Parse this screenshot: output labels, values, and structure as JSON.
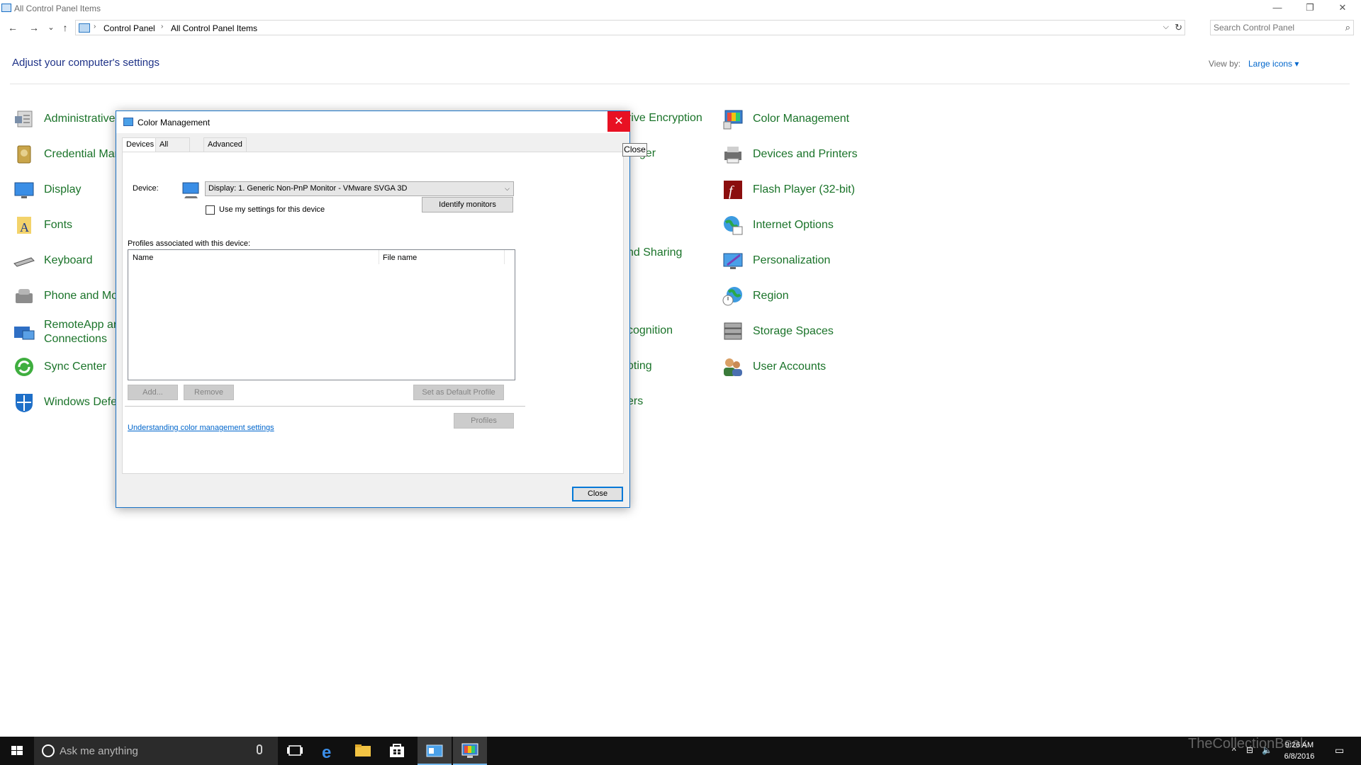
{
  "window": {
    "title": "All Control Panel Items",
    "minimize_glyph": "—",
    "restore_glyph": "❐",
    "close_glyph": "✕"
  },
  "nav": {
    "back_glyph": "←",
    "forward_glyph": "→",
    "recent_glyph": "⌄",
    "up_glyph": "↑",
    "breadcrumb": [
      "Control Panel",
      "All Control Panel Items"
    ],
    "search_placeholder": "Search Control Panel"
  },
  "content": {
    "heading": "Adjust your computer's settings",
    "view_by_label": "View by:",
    "view_by_value": "Large icons ▾"
  },
  "items": {
    "col1": [
      {
        "label": "Administrative",
        "icon": "admin-tools-icon"
      },
      {
        "label": "Credential Mar",
        "icon": "credential-icon"
      },
      {
        "label": "Display",
        "icon": "display-icon"
      },
      {
        "label": "Fonts",
        "icon": "fonts-icon"
      },
      {
        "label": "Keyboard",
        "icon": "keyboard-icon"
      },
      {
        "label": "Phone and Mo",
        "icon": "phone-modem-icon"
      },
      {
        "label": "RemoteApp an",
        "label2": "Connections",
        "icon": "remoteapp-icon"
      },
      {
        "label": "Sync Center",
        "icon": "sync-icon"
      },
      {
        "label": "Windows Defe",
        "icon": "defender-icon"
      }
    ],
    "col3_fragments": [
      "rive Encryption",
      "ager",
      "nd Sharing",
      "cognition",
      "oting",
      "ers"
    ],
    "col4": [
      {
        "label": "Color Management",
        "icon": "color-management-icon"
      },
      {
        "label": "Devices and Printers",
        "icon": "printer-icon"
      },
      {
        "label": "Flash Player (32-bit)",
        "icon": "flash-icon"
      },
      {
        "label": "Internet Options",
        "icon": "internet-options-icon"
      },
      {
        "label": "Personalization",
        "icon": "personalization-icon"
      },
      {
        "label": "Region",
        "icon": "region-icon"
      },
      {
        "label": "Storage Spaces",
        "icon": "storage-icon"
      },
      {
        "label": "User Accounts",
        "icon": "users-icon"
      }
    ]
  },
  "dialog": {
    "title": "Color Management",
    "close_glyph": "✕",
    "tooltip": "Close",
    "tabs": [
      "Devices",
      "All Profiles",
      "Advanced"
    ],
    "device_label": "Device:",
    "device_value": "Display: 1. Generic Non-PnP Monitor - VMware SVGA 3D",
    "device_arrow": "⌵",
    "use_settings_label": "Use my settings for this device",
    "identify_button": "Identify monitors",
    "profiles_label": "Profiles associated with this device:",
    "columns": [
      "Name",
      "File name"
    ],
    "add_button": "Add...",
    "remove_button": "Remove",
    "set_default_button": "Set as Default Profile",
    "profiles_button": "Profiles",
    "help_link": "Understanding color management settings",
    "close_button": "Close"
  },
  "taskbar": {
    "search_placeholder": "Ask me anything",
    "time": "9:26 AM",
    "date": "6/8/2016",
    "watermark": "TheCollectionBook"
  },
  "colors": {
    "link_green": "#1a7329",
    "heading_blue": "#1e3287",
    "close_red": "#e81123",
    "accent_blue": "#0078d7"
  }
}
